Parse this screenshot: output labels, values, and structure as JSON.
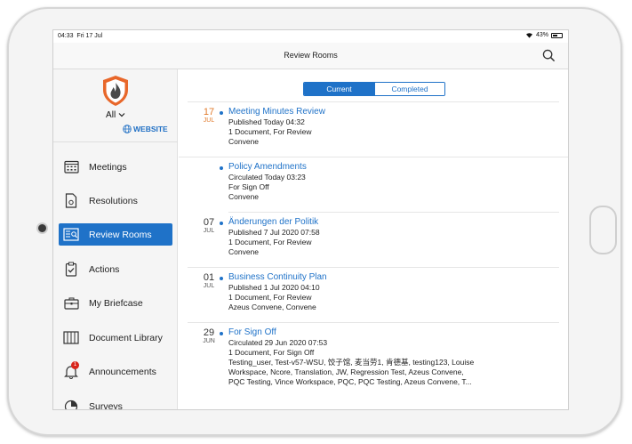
{
  "status": {
    "time": "04:33",
    "date": "Fri 17 Jul",
    "battery": "43%"
  },
  "header": {
    "title": "Review Rooms"
  },
  "sidebar": {
    "filter": "All",
    "website": "WEBSITE",
    "items": [
      {
        "label": "Meetings",
        "icon": "calendar-icon"
      },
      {
        "label": "Resolutions",
        "icon": "document-icon"
      },
      {
        "label": "Review Rooms",
        "icon": "review-room-icon",
        "active": true
      },
      {
        "label": "Actions",
        "icon": "clipboard-check-icon"
      },
      {
        "label": "My Briefcase",
        "icon": "briefcase-icon"
      },
      {
        "label": "Document Library",
        "icon": "library-icon"
      },
      {
        "label": "Announcements",
        "icon": "bell-icon",
        "badge": "1"
      },
      {
        "label": "Surveys",
        "icon": "pie-icon"
      }
    ]
  },
  "tabs": {
    "current": "Current",
    "completed": "Completed"
  },
  "rooms": [
    {
      "day": "17",
      "month": "JUL",
      "title": "Meeting Minutes Review",
      "lines": [
        "Published Today 04:32",
        "1 Document, For Review",
        "Convene"
      ]
    },
    {
      "day": "",
      "month": "",
      "title": "Policy Amendments",
      "lines": [
        "Circulated Today 03:23",
        "For Sign Off",
        "Convene"
      ]
    },
    {
      "day": "07",
      "month": "JUL",
      "title": "Änderungen der Politik",
      "lines": [
        "Published 7 Jul 2020 07:58",
        "1 Document, For Review",
        "Convene"
      ]
    },
    {
      "day": "01",
      "month": "JUL",
      "title": "Business Continuity Plan",
      "lines": [
        "Published 1 Jul 2020 04:10",
        "1 Document, For Review",
        "Azeus Convene, Convene"
      ]
    },
    {
      "day": "29",
      "month": "JUN",
      "title": "For Sign Off",
      "lines": [
        "Circulated 29 Jun 2020 07:53",
        "1 Document, For Sign Off",
        "Testing_user, Test-v57-WSU, 饺子馆, 麦当劳1, 肯德基, testing123, Louise",
        "Workspace, Ncore, Translation, JW, Regression Test, Azeus Convene,",
        "PQC Testing, Vince Workspace, PQC, PQC Testing, Azeus Convene, T..."
      ]
    }
  ],
  "colors": {
    "accent": "#1f72c8",
    "today": "#e07a2b",
    "logo": "#e8672a"
  }
}
